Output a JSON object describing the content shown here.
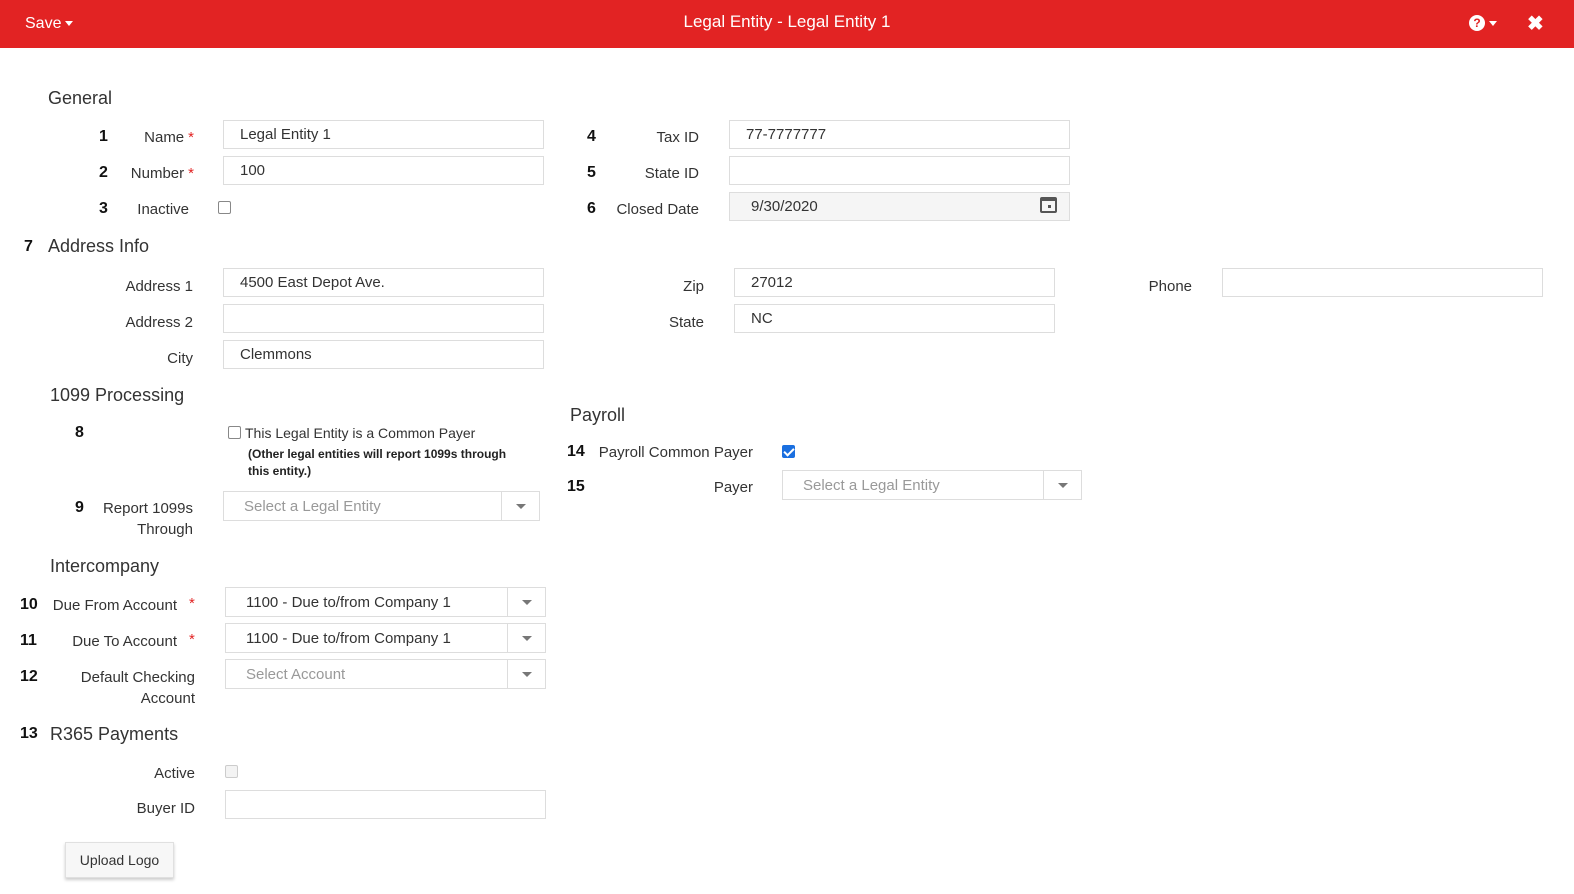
{
  "header": {
    "save_label": "Save",
    "title": "Legal Entity - Legal Entity 1",
    "help_icon": "?",
    "close_icon": "✖"
  },
  "general": {
    "heading": "General",
    "name": {
      "num": "1",
      "label": "Name",
      "value": "Legal Entity 1"
    },
    "number": {
      "num": "2",
      "label": "Number",
      "value": "100"
    },
    "inactive": {
      "num": "3",
      "label": "Inactive",
      "checked": false
    },
    "tax_id": {
      "num": "4",
      "label": "Tax ID",
      "value": "77-7777777"
    },
    "state_id": {
      "num": "5",
      "label": "State ID",
      "value": ""
    },
    "closed_date": {
      "num": "6",
      "label": "Closed Date",
      "value": "9/30/2020"
    }
  },
  "address": {
    "num": "7",
    "heading": "Address Info",
    "address1": {
      "label": "Address 1",
      "value": "4500 East Depot Ave."
    },
    "address2": {
      "label": "Address 2",
      "value": ""
    },
    "city": {
      "label": "City",
      "value": "Clemmons"
    },
    "zip": {
      "label": "Zip",
      "value": "27012"
    },
    "state": {
      "label": "State",
      "value": "NC"
    },
    "phone": {
      "label": "Phone",
      "value": ""
    }
  },
  "processing_1099": {
    "heading": "1099 Processing",
    "common_payer": {
      "num": "8",
      "label": "This Legal Entity is a Common Payer",
      "note_line1": "(Other legal entities will report 1099s through",
      "note_line2": "this entity.)",
      "checked": false
    },
    "report_through": {
      "num": "9",
      "label_line1": "Report 1099s",
      "label_line2": "Through",
      "placeholder": "Select a Legal Entity"
    }
  },
  "payroll": {
    "heading": "Payroll",
    "common_payer": {
      "num": "14",
      "label": "Payroll Common Payer",
      "checked": true
    },
    "payer": {
      "num": "15",
      "label": "Payer",
      "placeholder": "Select a Legal Entity"
    }
  },
  "intercompany": {
    "heading": "Intercompany",
    "due_from": {
      "num": "10",
      "label": "Due From Account",
      "value": "1100 - Due to/from Company 1"
    },
    "due_to": {
      "num": "11",
      "label": "Due To Account",
      "value": "1100 - Due to/from Company 1"
    },
    "default_checking": {
      "num": "12",
      "label_line1": "Default Checking",
      "label_line2": "Account",
      "placeholder": "Select Account"
    }
  },
  "r365_payments": {
    "num": "13",
    "heading": "R365 Payments",
    "active": {
      "label": "Active",
      "checked": false
    },
    "buyer_id": {
      "label": "Buyer ID",
      "value": ""
    }
  },
  "upload_logo_label": "Upload Logo",
  "required_mark": "*"
}
